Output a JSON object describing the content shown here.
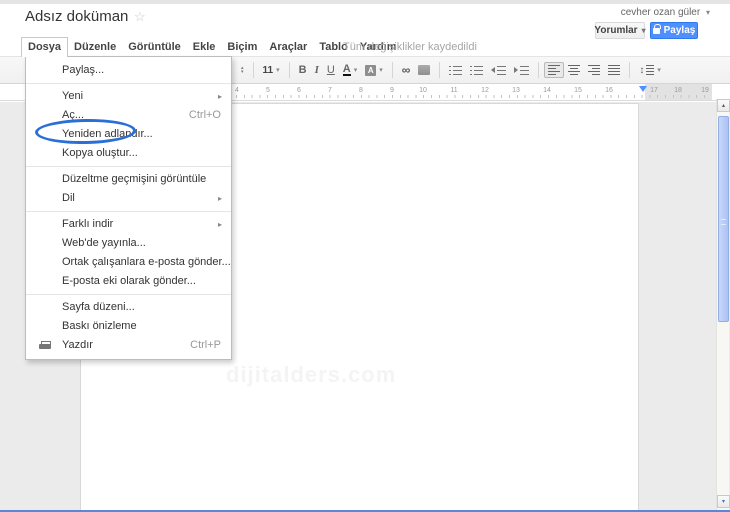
{
  "header": {
    "account": "cevher ozan güler",
    "doc_title": "Adsız doküman",
    "comments_label": "Yorumlar",
    "share_label": "Paylaş",
    "save_status": "Tüm değişiklikler kaydedildi"
  },
  "menubar": {
    "file": "Dosya",
    "edit": "Düzenle",
    "view": "Görüntüle",
    "insert": "Ekle",
    "format": "Biçim",
    "tools": "Araçlar",
    "table": "Tablo",
    "help": "Yardım"
  },
  "file_menu": {
    "share": "Paylaş...",
    "new": "Yeni",
    "open": "Aç...",
    "open_shortcut": "Ctrl+O",
    "rename": "Yeniden adlandır...",
    "make_copy": "Kopya oluştur...",
    "revision_history": "Düzeltme geçmişini görüntüle",
    "language": "Dil",
    "download_as": "Farklı indir",
    "publish_web": "Web'de yayınla...",
    "email_collaborators": "Ortak çalışanlara e-posta gönder...",
    "email_attachment": "E-posta eki olarak gönder...",
    "page_setup": "Sayfa düzeni...",
    "print_preview": "Baskı önizleme",
    "print": "Yazdır",
    "print_shortcut": "Ctrl+P"
  },
  "toolbar": {
    "font_size": "11",
    "bold": "B",
    "italic": "I",
    "underline": "U",
    "text_color": "A",
    "highlight": "A",
    "link_glyph": "∞",
    "line_spacing_glyph": "↕"
  },
  "icons": {
    "star": "☆",
    "dropdown_arrow": "▾",
    "submenu_arrow": "▸",
    "up_arrow": "▴",
    "down_arrow": "▾"
  },
  "ruler": {
    "numbers": [
      "4",
      "5",
      "6",
      "7",
      "8",
      "9",
      "10",
      "11",
      "12",
      "13",
      "14",
      "15",
      "16",
      "17",
      "18",
      "19"
    ]
  },
  "page": {
    "watermark": "dijitalders.com"
  },
  "colors": {
    "accent_blue": "#4d90fe",
    "annotation_blue": "#2b6fd6"
  }
}
